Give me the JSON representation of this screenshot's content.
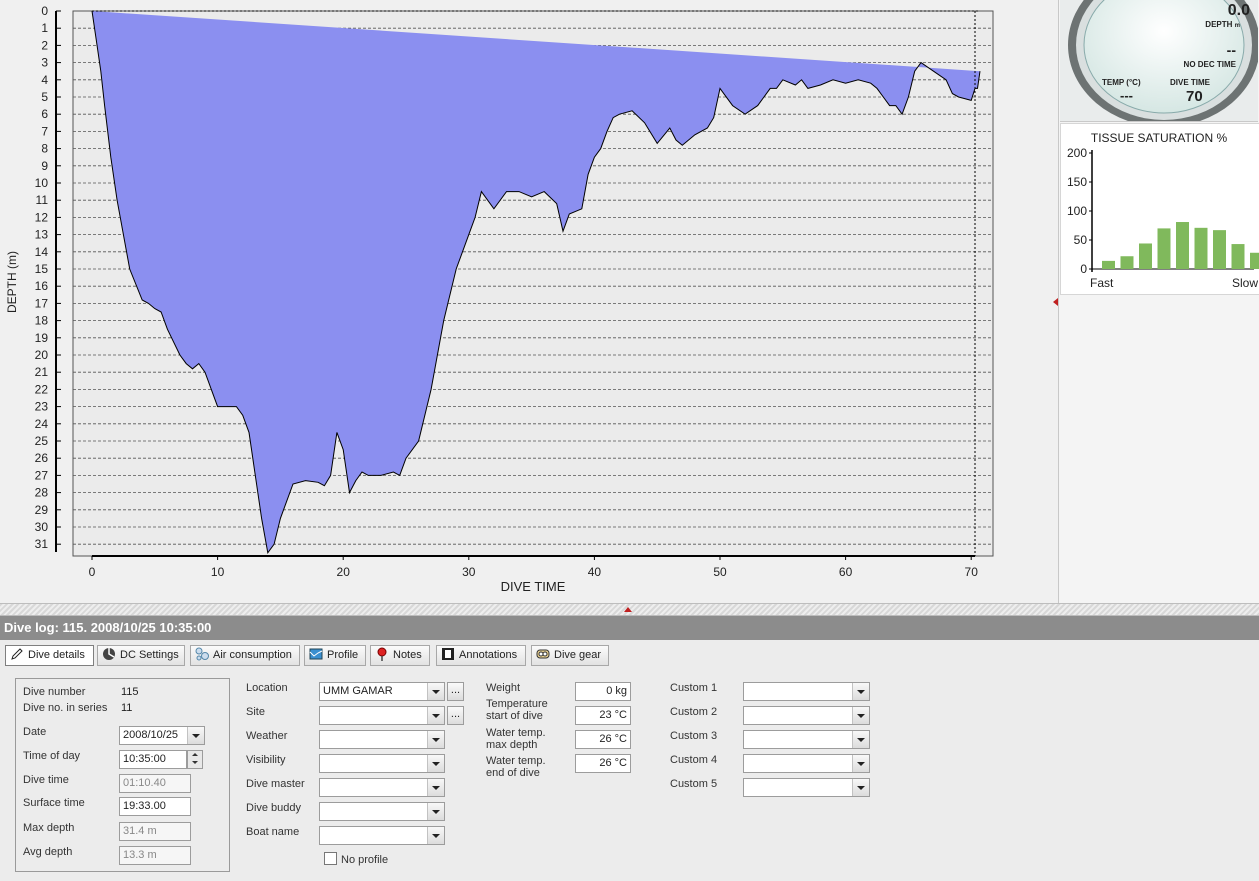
{
  "profile_chart": {
    "ylabel": "DEPTH (m)",
    "xlabel": "DIVE TIME",
    "y_ticks": [
      "0",
      "1",
      "2",
      "3",
      "4",
      "5",
      "6",
      "7",
      "8",
      "9",
      "10",
      "11",
      "12",
      "13",
      "14",
      "15",
      "16",
      "17",
      "18",
      "19",
      "20",
      "21",
      "22",
      "23",
      "24",
      "25",
      "26",
      "27",
      "28",
      "29",
      "30",
      "31"
    ],
    "x_ticks": [
      "0",
      "10",
      "20",
      "30",
      "40",
      "50",
      "60",
      "70"
    ],
    "colors": {
      "fill": "#8b8ff0",
      "line": "#000000",
      "plot_bg": "#ebebeb"
    }
  },
  "chart_data": [
    {
      "type": "area",
      "xlabel": "DIVE TIME",
      "ylabel": "DEPTH (m)",
      "xlim": [
        0,
        71
      ],
      "ylim": [
        31.5,
        0
      ],
      "grid": true,
      "x": [
        0,
        0.3,
        0.7,
        1,
        1.5,
        2,
        3,
        4,
        4.5,
        5,
        5.5,
        6,
        7,
        7.5,
        8,
        8.5,
        9,
        9.5,
        10,
        11,
        11.5,
        12,
        12.5,
        13,
        13.5,
        14,
        14.5,
        15,
        15.5,
        16,
        17,
        18,
        18.5,
        19,
        19.5,
        20,
        20.5,
        21,
        21.5,
        22,
        23,
        24,
        24.5,
        25,
        26,
        27,
        28,
        29,
        29.5,
        30,
        30.5,
        31,
        32,
        33,
        34,
        35,
        36,
        37,
        37.5,
        38,
        39,
        39.5,
        40,
        40.5,
        41,
        41.5,
        42,
        43,
        44,
        45,
        46,
        46.5,
        47,
        48,
        49,
        49.5,
        50,
        51,
        52,
        53,
        54,
        54.5,
        55,
        56,
        56.5,
        57,
        58,
        59,
        60,
        61,
        62,
        62.5,
        63,
        63.5,
        64,
        64.5,
        65,
        65.5,
        66,
        67,
        68,
        68.5,
        69,
        70,
        70.3,
        70.5,
        70.7
      ],
      "depth": [
        0,
        1.5,
        3.5,
        5.5,
        8.5,
        11,
        15,
        16.8,
        17,
        17.3,
        17.5,
        18.5,
        20,
        20.5,
        20.8,
        20.5,
        21,
        22,
        23,
        23,
        23,
        23.5,
        24.5,
        27,
        29.5,
        31.5,
        31,
        29.5,
        28.5,
        27.5,
        27.3,
        27.4,
        27.6,
        27,
        24.5,
        25.5,
        28,
        27.3,
        26.8,
        27,
        27,
        26.8,
        27,
        26,
        25,
        22,
        18,
        15,
        14,
        13,
        12,
        10.5,
        11.5,
        10.5,
        10.5,
        10.8,
        10.5,
        11.2,
        12.8,
        11.8,
        11.5,
        9.5,
        8.5,
        8,
        7,
        6.2,
        6,
        5.8,
        6.5,
        7.7,
        6.8,
        7.5,
        7.8,
        7.2,
        6.8,
        6.2,
        4.5,
        5.5,
        6,
        5.5,
        4.5,
        4.5,
        4,
        4.3,
        4,
        4.5,
        4.3,
        4,
        4.2,
        4,
        4.2,
        4.5,
        5,
        5.5,
        5.5,
        6,
        5,
        3.5,
        3,
        3.5,
        4,
        4.8,
        5,
        5.2,
        4.5,
        4.5,
        3.5,
        1,
        0
      ]
    },
    {
      "type": "bar",
      "title": "TISSUE SATURATION %",
      "categories": [
        "1",
        "2",
        "3",
        "4",
        "5",
        "6",
        "7",
        "8",
        "9"
      ],
      "values": [
        14,
        22,
        44,
        70,
        81,
        71,
        67,
        43,
        28
      ],
      "ylim": [
        0,
        200
      ],
      "y_ticks": [
        "0",
        "50",
        "100",
        "150",
        "200"
      ],
      "x_left_label": "Fast",
      "x_right_label": "Slow",
      "color": "#80b95c"
    }
  ],
  "gauge": {
    "depth_value": "0.0",
    "depth_label": "DEPTH",
    "depth_unit": "m",
    "dec_value": "--",
    "dec_label": "NO DEC TIME",
    "temp_label": "TEMP (°C)",
    "temp_value": "---",
    "time_label": "DIVE TIME",
    "time_value": "70"
  },
  "log_title": "Dive log: 115. 2008/10/25 10:35:00",
  "tabs": [
    {
      "label": "Dive details",
      "icon": "pencil-icon",
      "active": true
    },
    {
      "label": "DC Settings",
      "icon": "dc-settings-icon"
    },
    {
      "label": "Air consumption",
      "icon": "air-bubbles-icon"
    },
    {
      "label": "Profile",
      "icon": "profile-icon"
    },
    {
      "label": "Notes",
      "icon": "pin-icon"
    },
    {
      "label": "Annotations",
      "icon": "film-icon"
    },
    {
      "label": "Dive gear",
      "icon": "dive-gear-icon"
    }
  ],
  "details": {
    "dive_number_label": "Dive number",
    "dive_number": "115",
    "series_label": "Dive no. in series",
    "series": "11",
    "date_label": "Date",
    "date": "2008/10/25",
    "time_label": "Time of day",
    "time": "10:35:00",
    "dive_time_label": "Dive time",
    "dive_time": "01:10.40",
    "surface_time_label": "Surface time",
    "surface_time": "19:33.00",
    "max_depth_label": "Max depth",
    "max_depth": "31.4 m",
    "avg_depth_label": "Avg depth",
    "avg_depth": "13.3 m"
  },
  "site_fields": {
    "location_label": "Location",
    "location": "UMM GAMAR",
    "site_label": "Site",
    "site": "",
    "weather_label": "Weather",
    "weather": "",
    "visibility_label": "Visibility",
    "visibility": "",
    "divemaster_label": "Dive master",
    "divemaster": "",
    "buddy_label": "Dive buddy",
    "buddy": "",
    "boat_label": "Boat name",
    "boat": "",
    "no_profile_label": "No profile",
    "ellipsis": "..."
  },
  "env_fields": {
    "weight_label": "Weight",
    "weight": "0 kg",
    "temp_start_label_1": "Temperature",
    "temp_start_label_2": "start of dive",
    "temp_start": "23 °C",
    "temp_max_label_1": "Water temp.",
    "temp_max_label_2": "max depth",
    "temp_max": "26 °C",
    "temp_end_label_1": "Water temp.",
    "temp_end_label_2": "end of dive",
    "temp_end": "26 °C"
  },
  "custom_fields": {
    "c1_label": "Custom 1",
    "c1": "",
    "c2_label": "Custom 2",
    "c2": "",
    "c3_label": "Custom 3",
    "c3": "",
    "c4_label": "Custom 4",
    "c4": "",
    "c5_label": "Custom 5",
    "c5": ""
  }
}
